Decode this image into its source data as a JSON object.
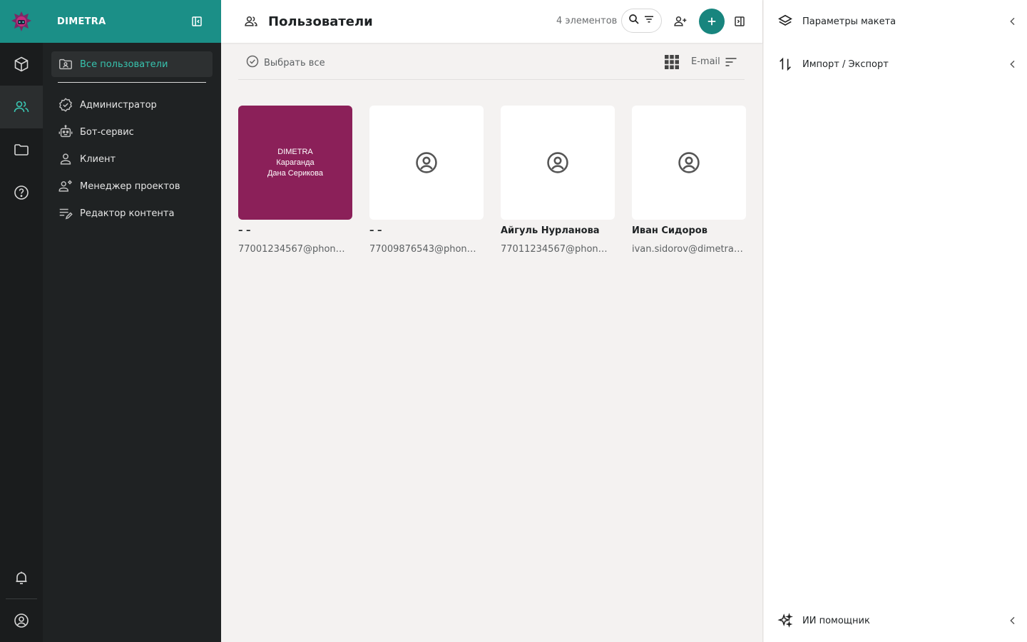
{
  "rail": {
    "items": [
      {
        "icon": "cube-icon"
      },
      {
        "icon": "users-icon"
      },
      {
        "icon": "folder-icon"
      },
      {
        "icon": "help-icon"
      }
    ],
    "bottom": [
      {
        "icon": "bell-icon"
      },
      {
        "icon": "account-circle-icon"
      }
    ]
  },
  "nav": {
    "brand": "DIMETRA",
    "items": [
      {
        "label": "Все пользователи",
        "icon": "folder-user-icon",
        "active": true
      },
      {
        "label": "Администратор",
        "icon": "verified-badge-icon"
      },
      {
        "label": "Бот-сервис",
        "icon": "robot-icon"
      },
      {
        "label": "Клиент",
        "icon": "person-icon"
      },
      {
        "label": "Менеджер проектов",
        "icon": "manager-icon"
      },
      {
        "label": "Редактор контента",
        "icon": "edit-note-icon"
      }
    ]
  },
  "header": {
    "title": "Пользователи",
    "count": "4 элементов"
  },
  "toolbar": {
    "select_all": "Выбрать все",
    "sort_label": "E-mail"
  },
  "cards": [
    {
      "name": "– –",
      "email": "77001234567@phone…",
      "thumb_lines": [
        "DIMETRA",
        "Караганда",
        "Дана Серикова"
      ],
      "thumb_color": "#8b2059"
    },
    {
      "name": "– –",
      "email": "77009876543@phon…"
    },
    {
      "name": "Айгуль Нурланова",
      "email": "77011234567@phone…"
    },
    {
      "name": "Иван Сидоров",
      "email": "ivan.sidorov@dimetra.…"
    }
  ],
  "right_panel": {
    "layout_params": "Параметры макета",
    "import_export": "Импорт / Экспорт",
    "ai_assistant": "ИИ помощник"
  },
  "colors": {
    "accent": "#1b8f87",
    "accent_text": "#37c3ae",
    "rail_bg": "#1a1c1d",
    "nav_bg": "#1f2223"
  }
}
